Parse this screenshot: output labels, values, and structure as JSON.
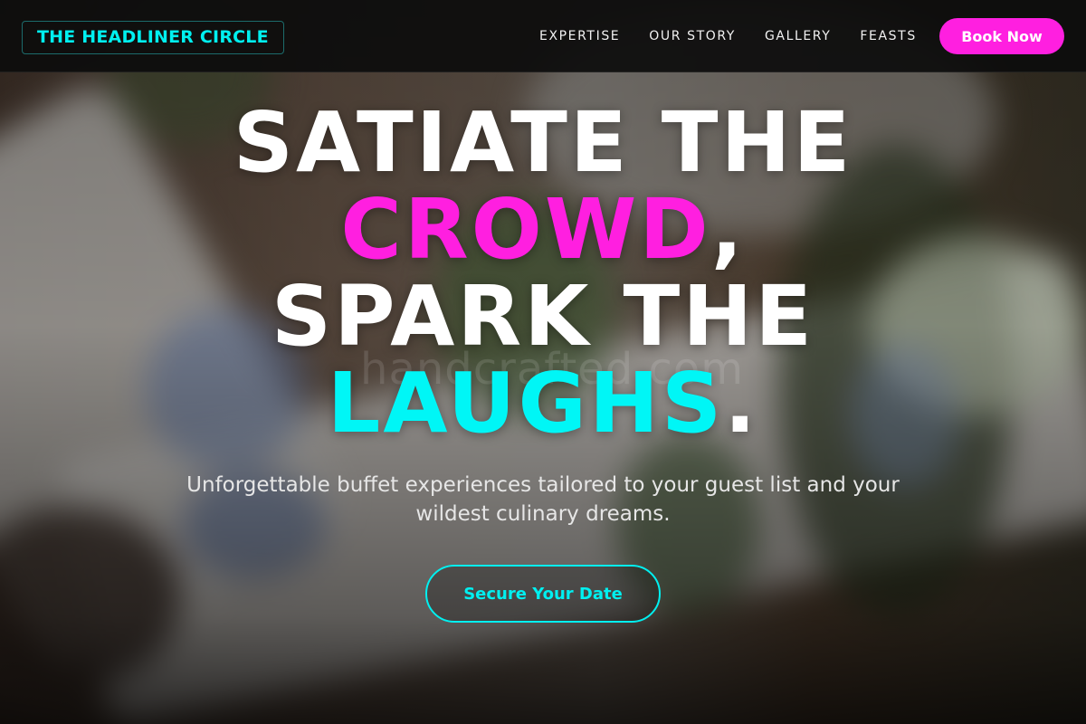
{
  "brand": {
    "logo_text": "THE HEADLINER CIRCLE",
    "accent_cyan": "#00f0f0",
    "accent_pink": "#ff1fe0"
  },
  "nav": {
    "items": [
      {
        "label": "EXPERTISE"
      },
      {
        "label": "OUR STORY"
      },
      {
        "label": "GALLERY"
      },
      {
        "label": "FEASTS"
      }
    ],
    "book_label": "Book Now"
  },
  "hero": {
    "headline": {
      "line1": "SATIATE THE",
      "line2_highlight": "CROWD",
      "line2_rest": ",",
      "line3": "SPARK THE",
      "line4_highlight": "LAUGHS",
      "line4_rest": "."
    },
    "subtitle": "Unforgettable buffet experiences tailored to your guest list and your wildest culinary dreams.",
    "cta_label": "Secure Your Date",
    "watermark": "handcrafted.com"
  }
}
